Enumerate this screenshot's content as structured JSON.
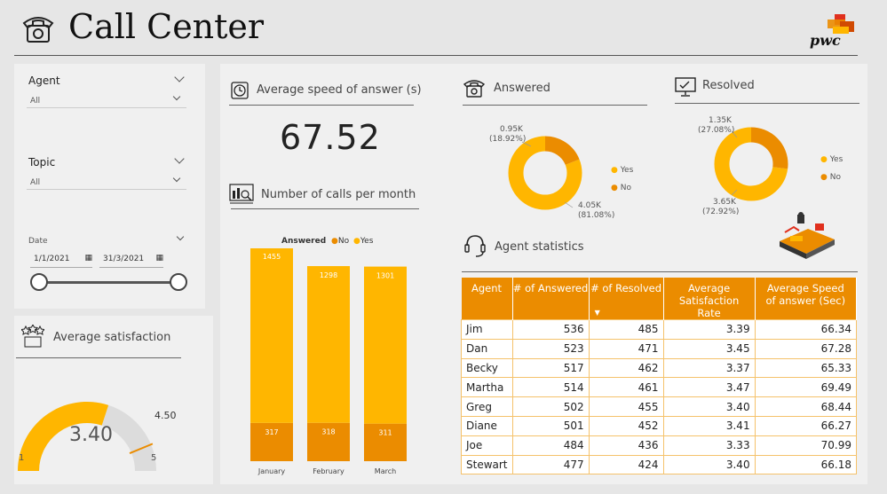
{
  "header": {
    "title": "Call Center",
    "logo_text": "pwc"
  },
  "filters": {
    "agent": {
      "label": "Agent",
      "value": "All"
    },
    "topic": {
      "label": "Topic",
      "value": "All"
    },
    "date": {
      "label": "Date",
      "start": "1/1/2021",
      "end": "31/3/2021",
      "range_fraction": [
        0,
        1
      ]
    }
  },
  "avg_speed": {
    "title": "Average speed of answer (s)",
    "value": "67.52"
  },
  "calls_per_month": {
    "title": "Number of calls per month",
    "legend_title": "Answered",
    "legend": [
      "No",
      "Yes"
    ]
  },
  "avg_satisfaction": {
    "title": "Average satisfaction",
    "value": "3.40",
    "min": "1",
    "max": "5",
    "target": "4.50"
  },
  "answered": {
    "title": "Answered",
    "no_label": "0.95K",
    "no_pct": "(18.92%)",
    "yes_label": "4.05K",
    "yes_pct": "(81.08%)",
    "legend_yes": "Yes",
    "legend_no": "No"
  },
  "resolved": {
    "title": "Resolved",
    "no_label": "1.35K",
    "no_pct": "(27.08%)",
    "yes_label": "3.65K",
    "yes_pct": "(72.92%)",
    "legend_yes": "Yes",
    "legend_no": "No"
  },
  "agent_stats": {
    "title": "Agent statistics",
    "columns": [
      "Agent",
      "# of Answered",
      "# of Resolved",
      "Average Satisfaction Rate",
      "Average Speed of answer (Sec)"
    ],
    "rows": [
      [
        "Jim",
        "536",
        "485",
        "3.39",
        "66.34"
      ],
      [
        "Dan",
        "523",
        "471",
        "3.45",
        "67.28"
      ],
      [
        "Becky",
        "517",
        "462",
        "3.37",
        "65.33"
      ],
      [
        "Martha",
        "514",
        "461",
        "3.47",
        "69.49"
      ],
      [
        "Greg",
        "502",
        "455",
        "3.40",
        "68.44"
      ],
      [
        "Diane",
        "501",
        "452",
        "3.41",
        "66.27"
      ],
      [
        "Joe",
        "484",
        "436",
        "3.33",
        "70.99"
      ],
      [
        "Stewart",
        "477",
        "424",
        "3.40",
        "66.18"
      ]
    ]
  },
  "colors": {
    "yes": "#ffb600",
    "no": "#eb8c00",
    "header": "#eb8c00"
  },
  "chart_data": [
    {
      "type": "bar",
      "stacked": true,
      "categories": [
        "January",
        "February",
        "March"
      ],
      "series": [
        {
          "name": "No",
          "values": [
            317,
            318,
            311
          ]
        },
        {
          "name": "Yes",
          "values": [
            1455,
            1298,
            1301
          ]
        }
      ]
    },
    {
      "type": "pie",
      "donut": true,
      "labels": [
        "Yes",
        "No"
      ],
      "values": [
        4050,
        950
      ],
      "percent": [
        81.08,
        18.92
      ]
    },
    {
      "type": "pie",
      "donut": true,
      "labels": [
        "Yes",
        "No"
      ],
      "values": [
        3650,
        1350
      ],
      "percent": [
        72.92,
        27.08
      ]
    },
    {
      "type": "gauge",
      "value": 3.4,
      "min": 1,
      "max": 5,
      "target": 4.5
    }
  ]
}
